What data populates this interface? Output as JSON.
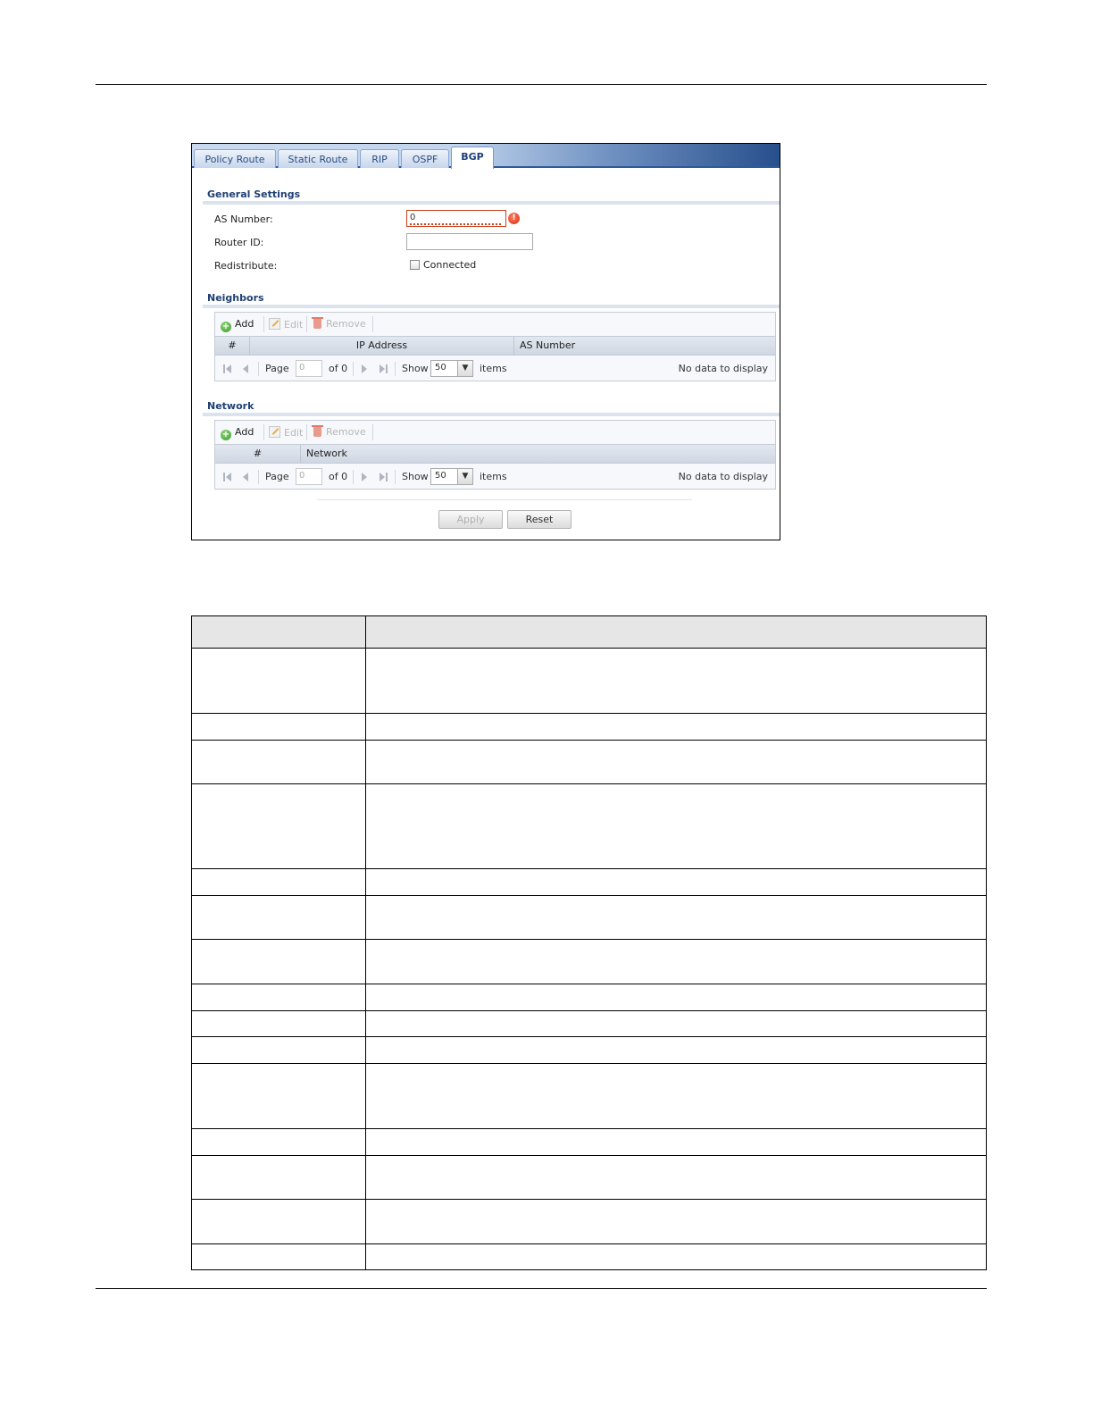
{
  "tabs": [
    {
      "label": "Policy Route",
      "active": false
    },
    {
      "label": "Static Route",
      "active": false
    },
    {
      "label": "RIP",
      "active": false
    },
    {
      "label": "OSPF",
      "active": false
    },
    {
      "label": "BGP",
      "active": true
    }
  ],
  "general": {
    "title": "General Settings",
    "as_number_label": "AS Number:",
    "as_number_value": "0",
    "router_id_label": "Router ID:",
    "router_id_value": "",
    "redistribute_label": "Redistribute:",
    "connected_label": "Connected",
    "connected_checked": false
  },
  "neighbors": {
    "title": "Neighbors",
    "toolbar": {
      "add": "Add",
      "edit": "Edit",
      "remove": "Remove"
    },
    "columns": [
      "#",
      "IP Address",
      "AS Number"
    ],
    "pager": {
      "page_label": "Page",
      "page_value": "0",
      "of_label": "of 0",
      "show_label": "Show",
      "show_value": "50",
      "items_label": "items",
      "status": "No data to display"
    }
  },
  "network": {
    "title": "Network",
    "toolbar": {
      "add": "Add",
      "edit": "Edit",
      "remove": "Remove"
    },
    "columns": [
      "#",
      "Network"
    ],
    "pager": {
      "page_label": "Page",
      "page_value": "0",
      "of_label": "of 0",
      "show_label": "Show",
      "show_value": "50",
      "items_label": "items",
      "status": "No data to display"
    }
  },
  "buttons": {
    "apply": "Apply",
    "reset": "Reset"
  },
  "colors": {
    "tab_accent": "#2e5a9a",
    "section_title": "#1f3f75",
    "error": "#d6301b"
  }
}
